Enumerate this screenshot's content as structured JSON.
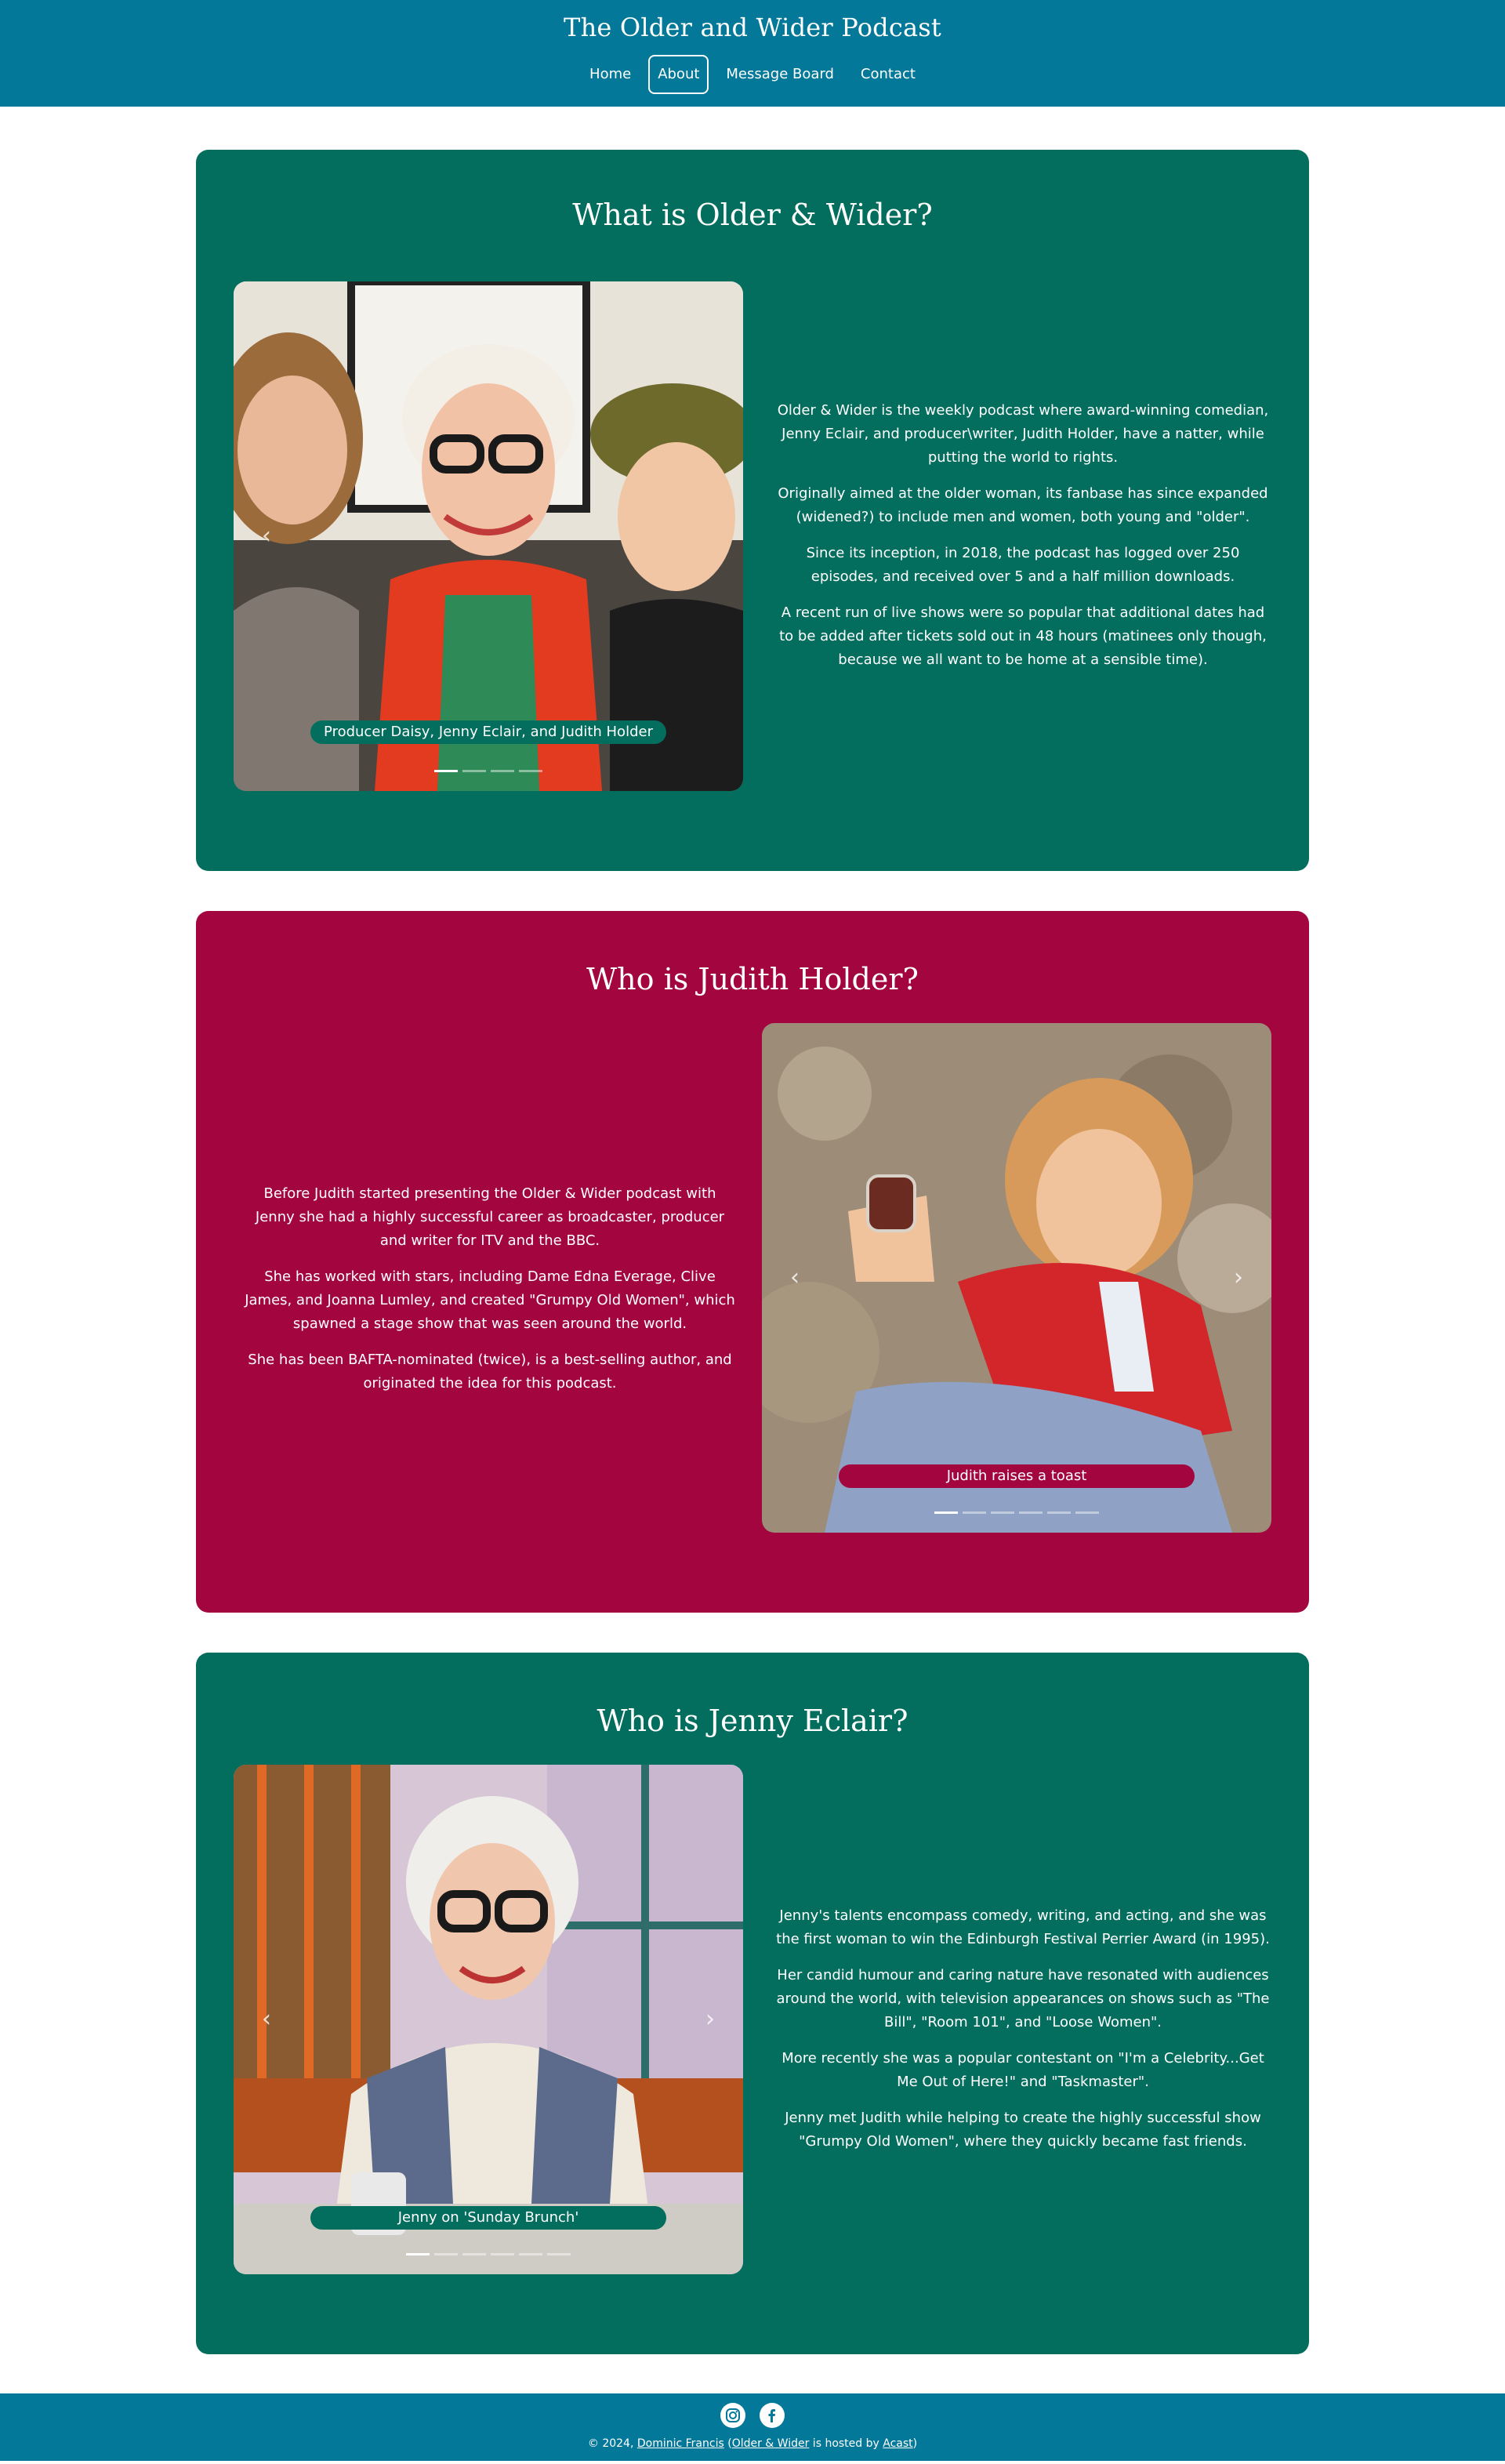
{
  "header": {
    "title": "The Older and Wider Podcast",
    "nav": [
      {
        "label": "Home"
      },
      {
        "label": "About",
        "active": true
      },
      {
        "label": "Message Board"
      },
      {
        "label": "Contact"
      }
    ]
  },
  "colors": {
    "header_bg": "#037899",
    "green_card": "#036d5e",
    "red_card": "#a3063f"
  },
  "sections": [
    {
      "heading": "What is Older & Wider?",
      "caption": "Producer Daisy, Jenny Eclair, and Judith Holder",
      "carousel_slides": 4,
      "active_slide": 1,
      "paragraphs": [
        "Older & Wider is the weekly podcast where award-winning comedian, Jenny Eclair, and producer\\writer, Judith Holder, have a natter, while putting the world to rights.",
        "Originally aimed at the older woman, its fanbase has since expanded (widened?) to include men and women, both young and \"older\".",
        "Since its inception, in 2018, the podcast has logged over 250 episodes, and received over 5 and a half million downloads.",
        "A recent run of live shows were so popular that additional dates had to be added after tickets sold out in 48 hours (matinees only though, because we all want to be home at a sensible time)."
      ]
    },
    {
      "heading": "Who is Judith Holder?",
      "caption": "Judith raises a toast",
      "carousel_slides": 6,
      "active_slide": 1,
      "paragraphs": [
        "Before Judith started presenting the Older & Wider podcast with Jenny she had a highly successful career as broadcaster, producer and writer for ITV and the BBC.",
        "She has worked with stars, including Dame Edna Everage, Clive James, and Joanna Lumley, and created \"Grumpy Old Women\", which spawned a stage show that was seen around the world.",
        "She has been BAFTA-nominated (twice), is a best-selling author, and originated the idea for this podcast."
      ]
    },
    {
      "heading": "Who is Jenny Eclair?",
      "caption": "Jenny on 'Sunday Brunch'",
      "carousel_slides": 6,
      "active_slide": 1,
      "paragraphs": [
        "Jenny's talents encompass comedy, writing, and acting, and she was the first woman to win the Edinburgh Festival Perrier Award (in 1995).",
        "Her candid humour and caring nature have resonated with audiences around the world, with television appearances on shows such as \"The Bill\", \"Room 101\", and \"Loose Women\".",
        "More recently she was a popular contestant on \"I'm a Celebrity...Get Me Out of Here!\" and \"Taskmaster\".",
        "Jenny met Judith while helping to create the highly successful show \"Grumpy Old Women\", where they quickly became fast friends."
      ]
    }
  ],
  "footer": {
    "social_icons": [
      "instagram-icon",
      "facebook-icon"
    ],
    "prefix": "© 2024, ",
    "author": "Dominic Francis",
    "open_paren": " (",
    "site_link": "Older & Wider",
    "hosted_text": " is hosted by ",
    "host": "Acast",
    "close_paren": ")"
  }
}
